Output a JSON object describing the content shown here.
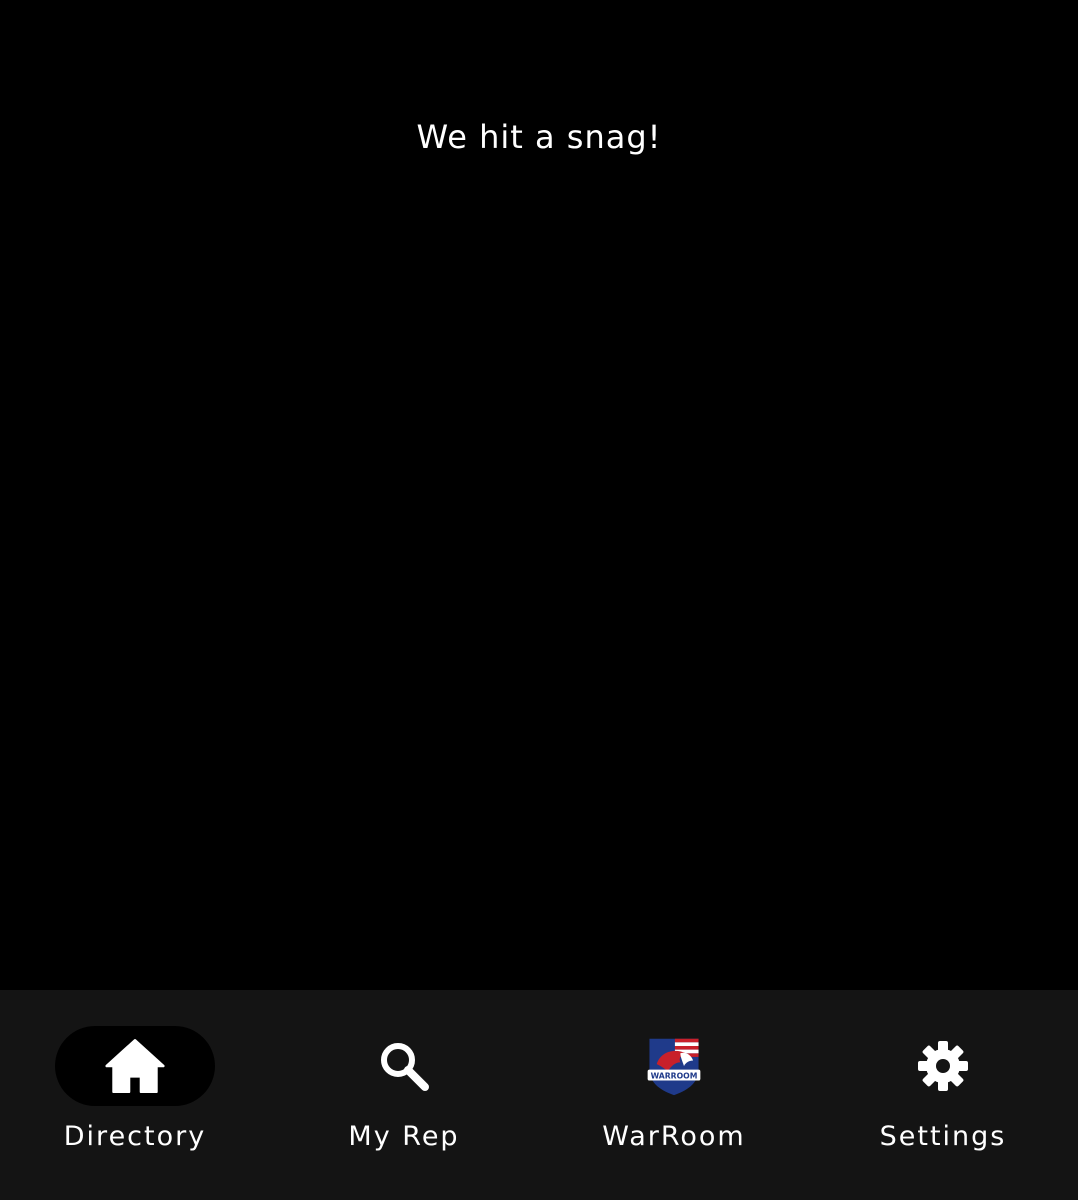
{
  "main": {
    "message": "We hit a snag!"
  },
  "tabbar": {
    "items": [
      {
        "label": "Directory",
        "icon": "home-icon",
        "active": true
      },
      {
        "label": "My Rep",
        "icon": "search-icon",
        "active": false
      },
      {
        "label": "WarRoom",
        "icon": "warroom-logo-icon",
        "active": false,
        "logo_text": "WARROOM"
      },
      {
        "label": "Settings",
        "icon": "gear-icon",
        "active": false
      }
    ]
  },
  "colors": {
    "background": "#000000",
    "tabbar_background": "#141414",
    "active_pill": "#000000",
    "text": "#ffffff",
    "logo_red": "#c8202a",
    "logo_blue": "#1f3a8a"
  }
}
